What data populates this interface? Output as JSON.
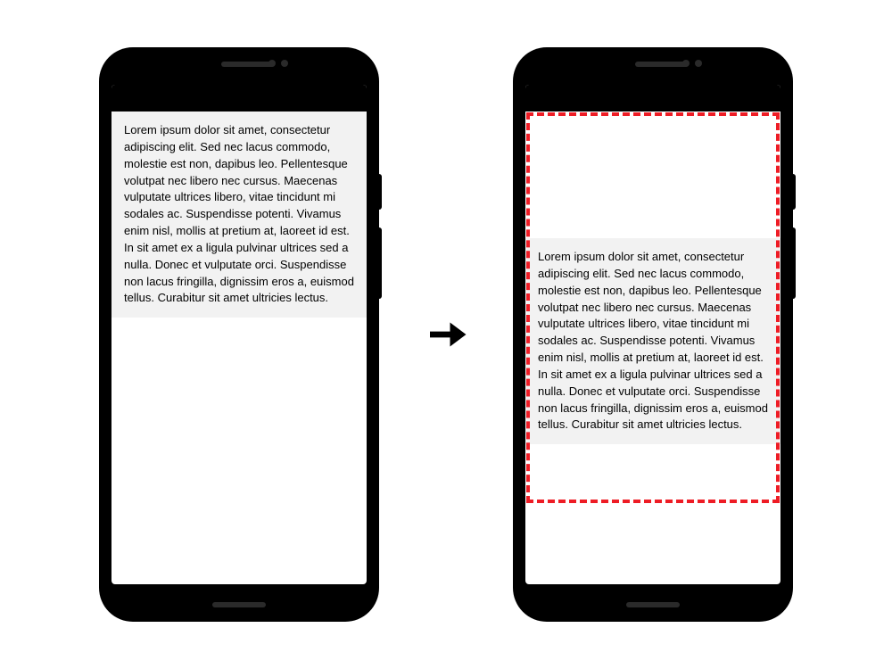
{
  "lorem_text": "Lorem ipsum dolor sit amet, consectetur adipiscing elit. Sed nec lacus commodo, molestie est non, dapibus leo. Pellentesque volutpat nec libero nec cursus. Maecenas vulputate ultrices libero, vitae tincidunt mi sodales ac. Suspendisse potenti. Vivamus enim nisl, mollis at pretium at, laoreet id est. In sit amet ex a ligula pulvinar ultrices sed a nulla. Donec et vulputate orci. Suspendisse non lacus fringilla, dignissim eros a, euismod tellus. Curabitur sit amet ultricies lectus.",
  "highlight_color": "#ee1c25"
}
